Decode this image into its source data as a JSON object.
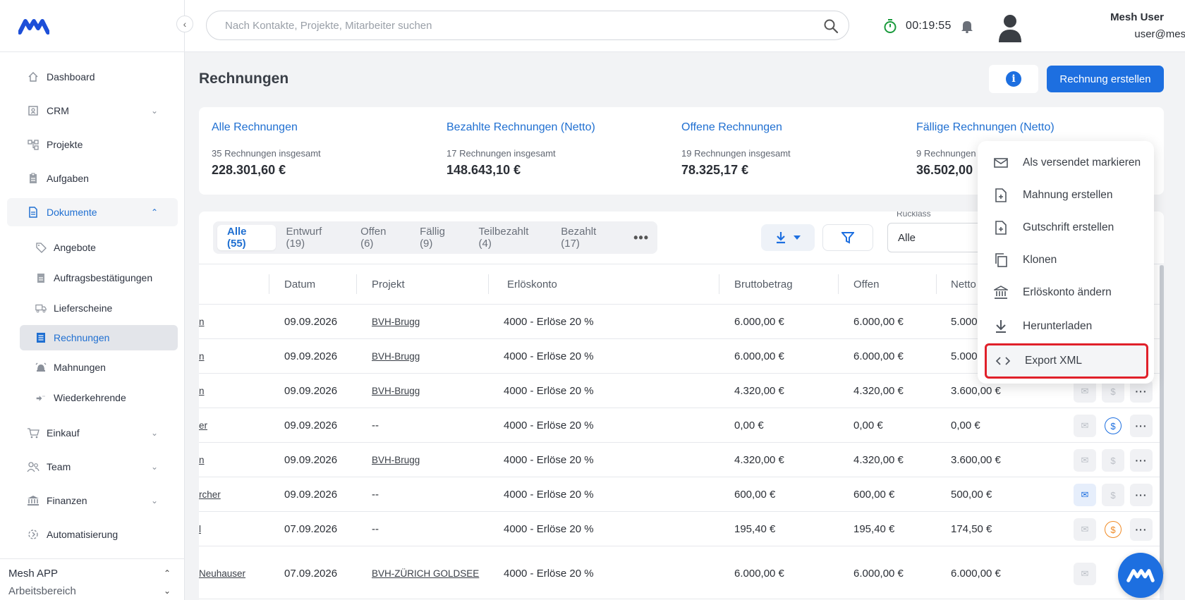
{
  "app": {
    "logo": "mesh-logo"
  },
  "search": {
    "placeholder": "Nach Kontakte, Projekte, Mitarbeiter suchen"
  },
  "timer": {
    "value": "00:19:55"
  },
  "user": {
    "name": "Mesh User",
    "email": "user@mesh-app.com"
  },
  "sidebar": {
    "items": [
      {
        "label": "Dashboard",
        "icon": "home-icon"
      },
      {
        "label": "CRM",
        "icon": "contact-card-icon"
      },
      {
        "label": "Projekte",
        "icon": "project-icon"
      },
      {
        "label": "Aufgaben",
        "icon": "clipboard-icon"
      },
      {
        "label": "Dokumente",
        "icon": "document-icon"
      },
      {
        "label": "Einkauf",
        "icon": "cart-icon"
      },
      {
        "label": "Team",
        "icon": "team-icon"
      },
      {
        "label": "Finanzen",
        "icon": "bank-icon"
      },
      {
        "label": "Automatisierung",
        "icon": "automation-icon"
      }
    ],
    "sub_items": [
      {
        "label": "Angebote",
        "icon": "tag-icon"
      },
      {
        "label": "Auftragsbestätigungen",
        "icon": "clipboard-icon"
      },
      {
        "label": "Lieferscheine",
        "icon": "truck-icon"
      },
      {
        "label": "Rechnungen",
        "icon": "invoice-icon"
      },
      {
        "label": "Mahnungen",
        "icon": "alarm-icon"
      },
      {
        "label": "Wiederkehrende",
        "icon": "repeat-icon"
      }
    ],
    "workspace": {
      "name": "Mesh APP",
      "sub": "Arbeitsbereich"
    }
  },
  "page": {
    "title": "Rechnungen",
    "create_label": "Rechnung erstellen"
  },
  "summary": [
    {
      "title": "Alle Rechnungen",
      "sub": "35 Rechnungen insgesamt",
      "value": "228.301,60 €"
    },
    {
      "title": "Bezahlte Rechnungen (Netto)",
      "sub": "17 Rechnungen insgesamt",
      "value": "148.643,10 €"
    },
    {
      "title": "Offene Rechnungen",
      "sub": "19 Rechnungen insgesamt",
      "value": "78.325,17 €"
    },
    {
      "title": "Fällige Rechnungen (Netto)",
      "sub": "9 Rechnungen",
      "value": "36.502,00"
    }
  ],
  "tabs": [
    "Alle (55)",
    "Entwurf (19)",
    "Offen (6)",
    "Fällig (9)",
    "Teilbezahlt (4)",
    "Bezahlt (17)"
  ],
  "filter": {
    "label": "Rücklass",
    "value": "Alle"
  },
  "table": {
    "headers": [
      "Datum",
      "Projekt",
      "Erlöskonto",
      "Bruttobetrag",
      "Offen",
      "Netto"
    ],
    "rows": [
      {
        "name": "n",
        "datum": "09.09.2026",
        "projekt": "BVH-Brugg",
        "konto": "4000 - Erlöse 20 %",
        "brutto": "6.000,00 €",
        "offen": "6.000,00 €",
        "netto": "5.000"
      },
      {
        "name": "n",
        "datum": "09.09.2026",
        "projekt": "BVH-Brugg",
        "konto": "4000 - Erlöse 20 %",
        "brutto": "6.000,00 €",
        "offen": "6.000,00 €",
        "netto": "5.000"
      },
      {
        "name": "n",
        "datum": "09.09.2026",
        "projekt": "BVH-Brugg",
        "konto": "4000 - Erlöse 20 %",
        "brutto": "4.320,00 €",
        "offen": "4.320,00 €",
        "netto": "3.600,00 €"
      },
      {
        "name": "er",
        "datum": "09.09.2026",
        "projekt": "--",
        "konto": "4000 - Erlöse 20 %",
        "brutto": "0,00 €",
        "offen": "0,00 €",
        "netto": "0,00 €"
      },
      {
        "name": "n",
        "datum": "09.09.2026",
        "projekt": "BVH-Brugg",
        "konto": "4000 - Erlöse 20 %",
        "brutto": "4.320,00 €",
        "offen": "4.320,00 €",
        "netto": "3.600,00 €"
      },
      {
        "name": "rcher",
        "datum": "09.09.2026",
        "projekt": "--",
        "konto": "4000 - Erlöse 20 %",
        "brutto": "600,00 €",
        "offen": "600,00 €",
        "netto": "500,00 €"
      },
      {
        "name": "l",
        "datum": "07.09.2026",
        "projekt": "--",
        "konto": "4000 - Erlöse 20 %",
        "brutto": "195,40 €",
        "offen": "195,40 €",
        "netto": "174,50 €"
      },
      {
        "name": "Neuhauser",
        "datum": "07.09.2026",
        "projekt": "BVH-ZÜRICH GOLDSEE",
        "konto": "4000 - Erlöse 20 %",
        "brutto": "6.000,00 €",
        "offen": "6.000,00 €",
        "netto": "6.000,00 €"
      }
    ]
  },
  "menu": {
    "items": [
      {
        "label": "Als versendet markieren",
        "icon": "envelope-icon"
      },
      {
        "label": "Mahnung erstellen",
        "icon": "file-plus-icon"
      },
      {
        "label": "Gutschrift erstellen",
        "icon": "file-plus-icon"
      },
      {
        "label": "Klonen",
        "icon": "copy-icon"
      },
      {
        "label": "Erlöskonto ändern",
        "icon": "bank-icon"
      },
      {
        "label": "Herunterladen",
        "icon": "download-icon"
      },
      {
        "label": "Export XML",
        "icon": "code-icon"
      }
    ]
  },
  "colors": {
    "accent": "#1d6fe0",
    "highlight": "#e0202a",
    "timer": "#1a9a3c"
  }
}
